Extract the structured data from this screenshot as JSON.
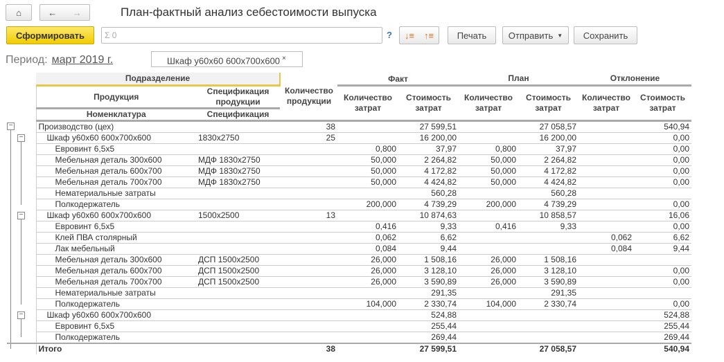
{
  "title": "План-фактный анализ себестоимости выпуска",
  "toolbar": {
    "generate": "Сформировать",
    "search_value": "Σ 0",
    "help": "?",
    "print": "Печать",
    "send": "Отправить",
    "save": "Сохранить"
  },
  "period": {
    "label": "Период:",
    "value": "март 2019 г."
  },
  "filter": {
    "value": "Шкаф у60х60 600х700х600",
    "clear": "×"
  },
  "headers": {
    "division": "Подразделение",
    "product": "Продукция",
    "product_spec": "Спецификация продукции",
    "nomenclature": "Номенклатура",
    "spec": "Спецификация",
    "qty_product": "Количество продукции",
    "fact": "Факт",
    "plan": "План",
    "deviation": "Отклонение",
    "qty_cost": "Количество затрат",
    "cost": "Стоимость затрат"
  },
  "rows": [
    {
      "level": 0,
      "group": true,
      "name": "Производство (цех)",
      "spec": "",
      "qty": "38",
      "fq": "",
      "fc": "27 599,51",
      "pq": "",
      "pc": "27 058,57",
      "dq": "",
      "dc": "540,94"
    },
    {
      "level": 1,
      "group": true,
      "name": "Шкаф у60х60 600х700х600",
      "spec": "1830х2750",
      "qty": "25",
      "fq": "",
      "fc": "16 200,00",
      "pq": "",
      "pc": "16 200,00",
      "dq": "",
      "dc": "0,00"
    },
    {
      "level": 2,
      "name": "Евровинт 6,5х5",
      "spec": "",
      "qty": "",
      "fq": "0,800",
      "fc": "37,97",
      "pq": "0,800",
      "pc": "37,97",
      "dq": "",
      "dc": "0,00"
    },
    {
      "level": 2,
      "name": "Мебельная деталь 300х600",
      "spec": "МДФ 1830х2750",
      "qty": "",
      "fq": "50,000",
      "fc": "2 264,82",
      "pq": "50,000",
      "pc": "2 264,82",
      "dq": "",
      "dc": "0,00"
    },
    {
      "level": 2,
      "name": "Мебельная деталь 600х700",
      "spec": "МДФ 1830х2750",
      "qty": "",
      "fq": "50,000",
      "fc": "4 172,82",
      "pq": "50,000",
      "pc": "4 172,82",
      "dq": "",
      "dc": "0,00"
    },
    {
      "level": 2,
      "name": "Мебельная деталь 700х700",
      "spec": "МДФ 1830х2750",
      "qty": "",
      "fq": "50,000",
      "fc": "4 424,82",
      "pq": "50,000",
      "pc": "4 424,82",
      "dq": "",
      "dc": "0,00"
    },
    {
      "level": 2,
      "name": "Нематериальные затраты",
      "spec": "",
      "qty": "",
      "fq": "",
      "fc": "560,28",
      "pq": "",
      "pc": "560,28",
      "dq": "",
      "dc": ""
    },
    {
      "level": 2,
      "name": "Полкодержатель",
      "spec": "",
      "qty": "",
      "fq": "200,000",
      "fc": "4 739,29",
      "pq": "200,000",
      "pc": "4 739,29",
      "dq": "",
      "dc": "0,00"
    },
    {
      "level": 1,
      "group": true,
      "name": "Шкаф у60х60 600х700х600",
      "spec": "1500х2500",
      "qty": "13",
      "fq": "",
      "fc": "10 874,63",
      "pq": "",
      "pc": "10 858,57",
      "dq": "",
      "dc": "16,06"
    },
    {
      "level": 2,
      "name": "Евровинт 6,5х5",
      "spec": "",
      "qty": "",
      "fq": "0,416",
      "fc": "9,33",
      "pq": "0,416",
      "pc": "9,33",
      "dq": "",
      "dc": "0,00"
    },
    {
      "level": 2,
      "name": "Клей ПВА столярный",
      "spec": "",
      "qty": "",
      "fq": "0,062",
      "fc": "6,62",
      "pq": "",
      "pc": "",
      "dq": "0,062",
      "dc": "6,62"
    },
    {
      "level": 2,
      "name": "Лак мебельный",
      "spec": "",
      "qty": "",
      "fq": "0,084",
      "fc": "9,44",
      "pq": "",
      "pc": "",
      "dq": "0,084",
      "dc": "9,44"
    },
    {
      "level": 2,
      "name": "Мебельная деталь 300х600",
      "spec": "ДСП 1500х2500",
      "qty": "",
      "fq": "26,000",
      "fc": "1 508,16",
      "pq": "26,000",
      "pc": "1 508,16",
      "dq": "",
      "dc": ""
    },
    {
      "level": 2,
      "name": "Мебельная деталь 600х700",
      "spec": "ДСП 1500х2500",
      "qty": "",
      "fq": "26,000",
      "fc": "3 128,10",
      "pq": "26,000",
      "pc": "3 128,10",
      "dq": "",
      "dc": "0,00"
    },
    {
      "level": 2,
      "name": "Мебельная деталь 700х700",
      "spec": "ДСП 1500х2500",
      "qty": "",
      "fq": "26,000",
      "fc": "3 590,89",
      "pq": "26,000",
      "pc": "3 590,89",
      "dq": "",
      "dc": "0,00"
    },
    {
      "level": 2,
      "name": "Нематериальные затраты",
      "spec": "",
      "qty": "",
      "fq": "",
      "fc": "291,35",
      "pq": "",
      "pc": "291,35",
      "dq": "",
      "dc": ""
    },
    {
      "level": 2,
      "name": "Полкодержатель",
      "spec": "",
      "qty": "",
      "fq": "104,000",
      "fc": "2 330,74",
      "pq": "104,000",
      "pc": "2 330,74",
      "dq": "",
      "dc": "0,00"
    },
    {
      "level": 1,
      "group": true,
      "name": "Шкаф у60х60 600х700х600",
      "spec": "",
      "qty": "",
      "fq": "",
      "fc": "524,88",
      "pq": "",
      "pc": "",
      "dq": "",
      "dc": "524,88"
    },
    {
      "level": 2,
      "name": "Евровинт 6,5х5",
      "spec": "",
      "qty": "",
      "fq": "",
      "fc": "255,44",
      "pq": "",
      "pc": "",
      "dq": "",
      "dc": "255,44"
    },
    {
      "level": 2,
      "name": "Полкодержатель",
      "spec": "",
      "qty": "",
      "fq": "",
      "fc": "269,44",
      "pq": "",
      "pc": "",
      "dq": "",
      "dc": "269,44"
    }
  ],
  "total": {
    "name": "Итого",
    "qty": "38",
    "fc": "27 599,51",
    "pc": "27 058,57",
    "dc": "540,94"
  }
}
